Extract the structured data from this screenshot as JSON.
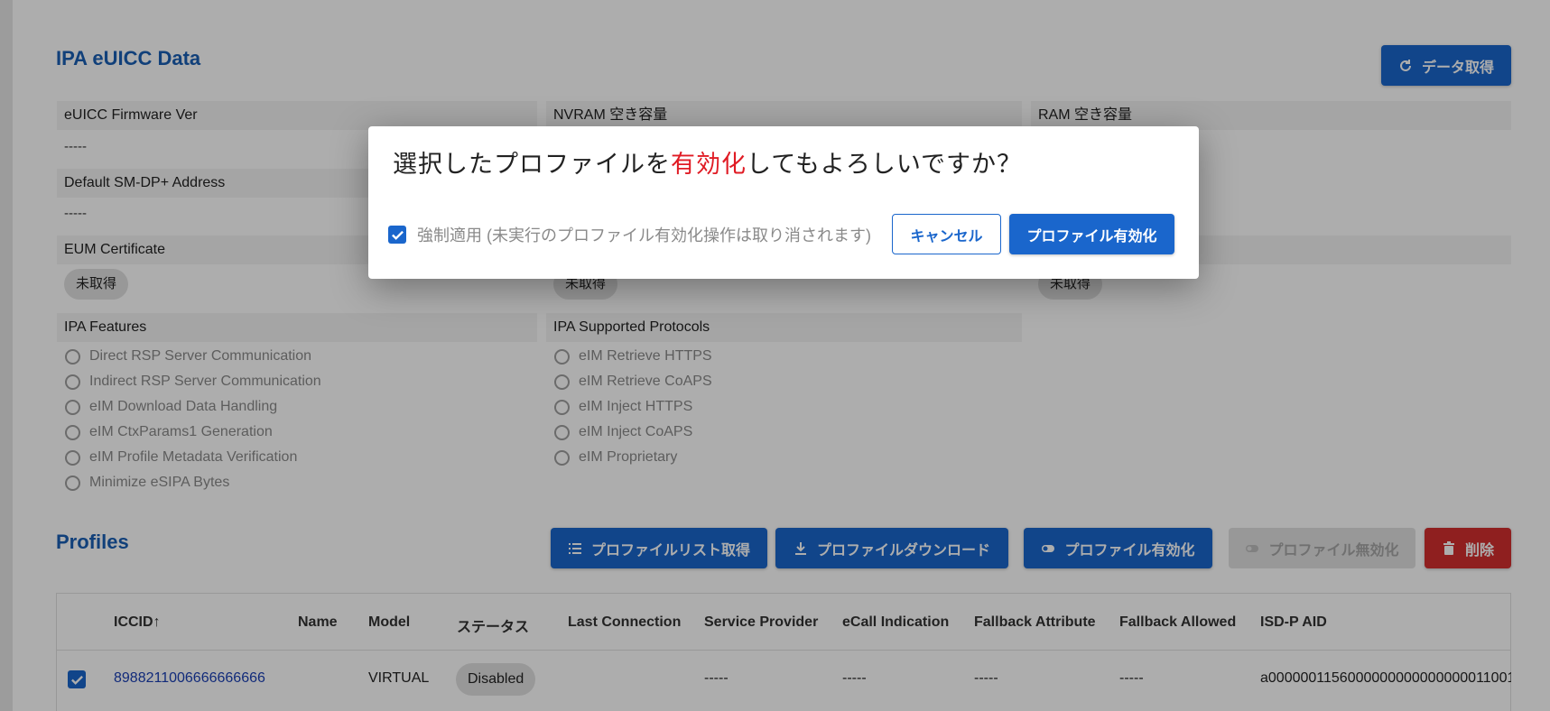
{
  "euicc": {
    "title": "IPA eUICC Data",
    "fetch_button": "データ取得",
    "fields": [
      {
        "label": "eUICC Firmware Ver",
        "value": "-----"
      },
      {
        "label": "NVRAM 空き容量",
        "value": ""
      },
      {
        "label": "RAM 空き容量",
        "value": ""
      },
      {
        "label": "Default SM-DP+ Address",
        "value": "-----"
      },
      {
        "label": "EUM Certificate",
        "value": "未取得"
      }
    ],
    "chips": [
      "未取得",
      "未取得"
    ],
    "ipa_features": {
      "label": "IPA Features",
      "items": [
        "Direct RSP Server Communication",
        "Indirect RSP Server Communication",
        "eIM Download Data Handling",
        "eIM CtxParams1 Generation",
        "eIM Profile Metadata Verification",
        "Minimize eSIPA Bytes"
      ]
    },
    "ipa_protocols": {
      "label": "IPA Supported Protocols",
      "items": [
        "eIM Retrieve HTTPS",
        "eIM Retrieve CoAPS",
        "eIM Inject HTTPS",
        "eIM Inject CoAPS",
        "eIM Proprietary"
      ]
    }
  },
  "profiles": {
    "title": "Profiles",
    "buttons": {
      "list": "プロファイルリスト取得",
      "download": "プロファイルダウンロード",
      "enable": "プロファイル有効化",
      "disable": "プロファイル無効化",
      "delete": "削除"
    },
    "columns": [
      "ICCID",
      "Name",
      "Model",
      "ステータス",
      "Last Connection",
      "Service Provider",
      "eCall Indication",
      "Fallback Attribute",
      "Fallback Allowed",
      "ISD-P AID"
    ],
    "sort_indicator": "↑",
    "rows": [
      {
        "iccid": "8988211006666666666",
        "name": "",
        "model": "VIRTUAL",
        "status": "Disabled",
        "last_connection": "",
        "service_provider": "-----",
        "ecall": "-----",
        "fallback_attribute": "-----",
        "fallback_allowed": "-----",
        "isdp_aid": "a0000001156000000000000000011001"
      }
    ]
  },
  "dialog": {
    "title_before": "選択したプロファイルを",
    "title_accent": "有効化",
    "title_after": "してもよろしいですか？",
    "force_label": "強制適用 (未実行のプロファイル有効化操作は取り消されます)",
    "cancel": "キャンセル",
    "confirm": "プロファイル有効化"
  },
  "colors": {
    "primary": "#1a66cc",
    "title_blue": "#1a5fb4",
    "danger": "#d32f2f",
    "accent_red": "#e01b24"
  }
}
